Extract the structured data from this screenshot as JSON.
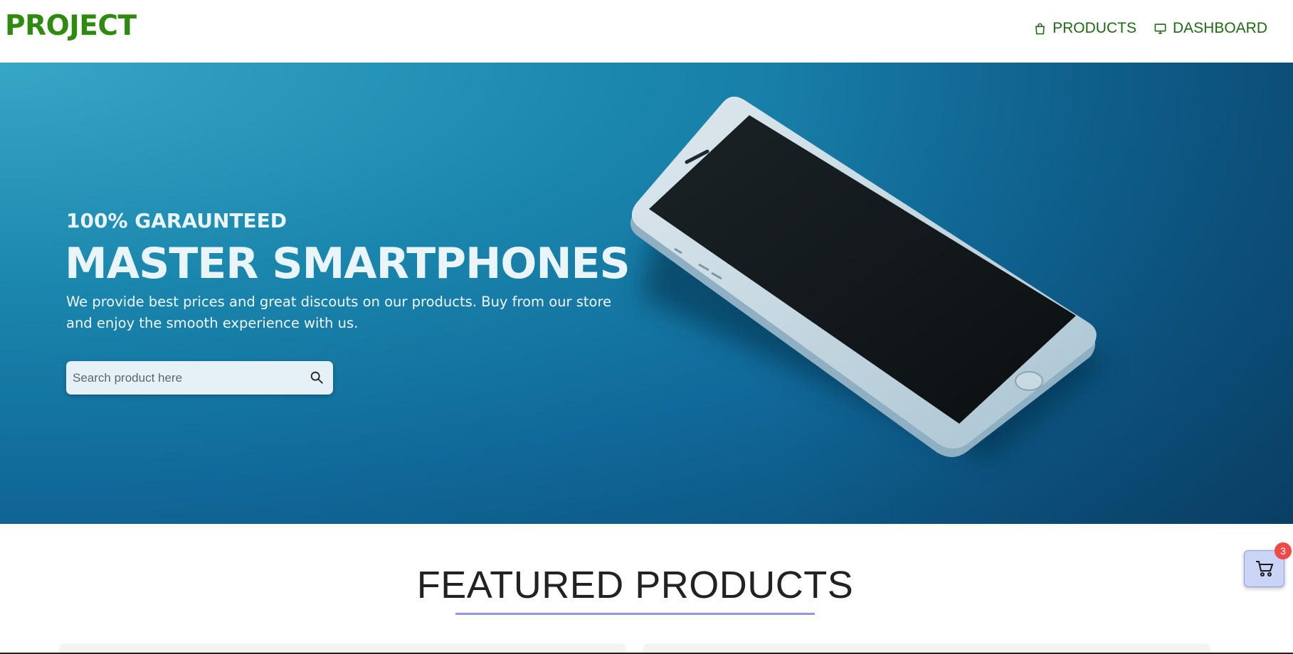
{
  "header": {
    "logo": "PROJECT",
    "nav": [
      {
        "label": "PRODUCTS",
        "icon": "shopping-bag-icon"
      },
      {
        "label": "DASHBOARD",
        "icon": "monitor-icon"
      }
    ]
  },
  "hero": {
    "kicker": "100% GARAUNTEED",
    "title": "MASTER SMARTPHONES",
    "description": "We provide best prices and great discouts on our products. Buy from our store and enjoy the smooth experience with us.",
    "search": {
      "placeholder": "Search product here",
      "value": "",
      "icon": "search-icon"
    }
  },
  "featured": {
    "title": "FEATURED PRODUCTS"
  },
  "cart": {
    "icon": "cart-icon",
    "count": "3"
  },
  "colors": {
    "brand_green": "#2e8b10",
    "nav_green": "#1d6a12",
    "hero_blue": "#10699a",
    "underline": "#8f95e8",
    "badge_red": "#ef4a4a",
    "cart_bg": "#c9d4f7"
  }
}
